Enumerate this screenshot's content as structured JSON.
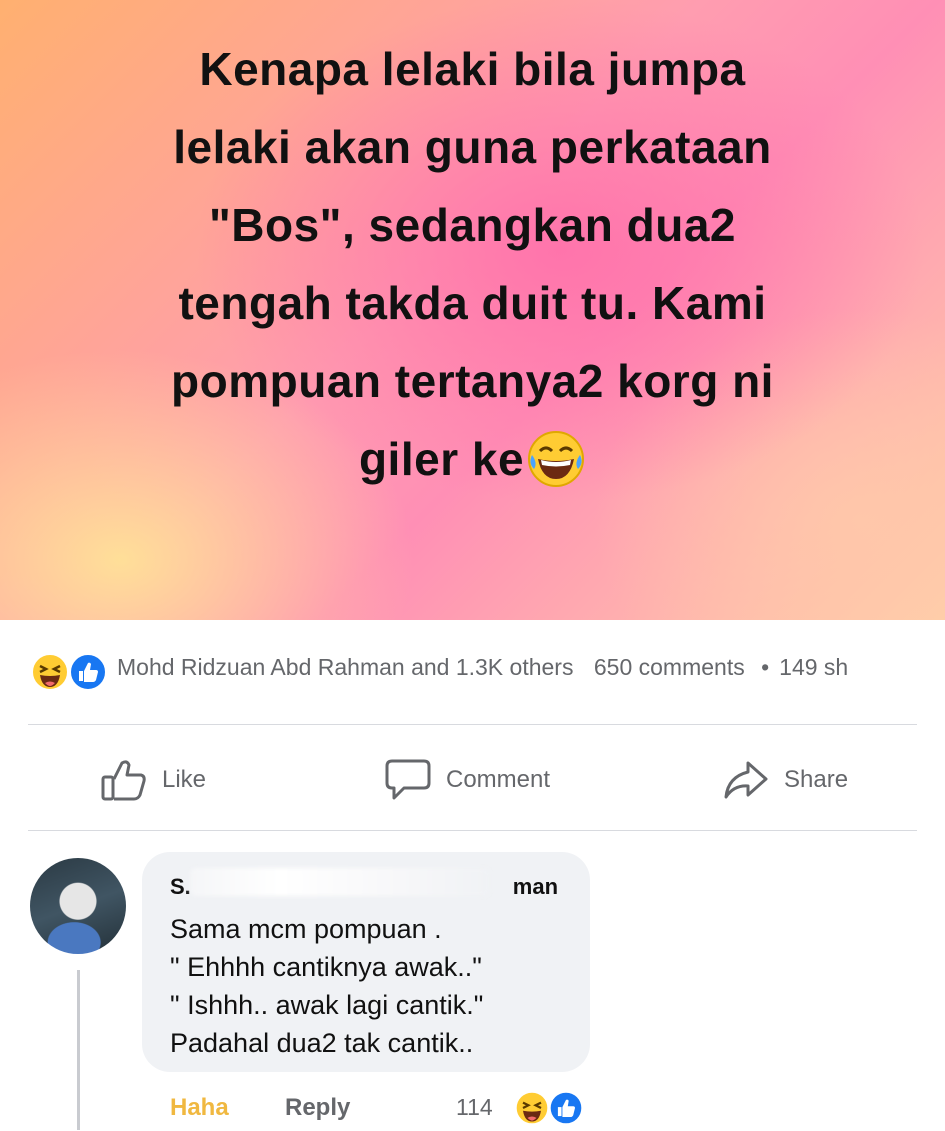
{
  "post": {
    "text_lines": [
      "Kenapa lelaki bila jumpa",
      "lelaki akan guna perkataan",
      "\"Bos\", sedangkan dua2",
      "tengah takda duit tu. Kami",
      "pompuan tertanya2 korg ni",
      "giler ke"
    ],
    "background_colors": [
      "#ffb070",
      "#ff8fb5",
      "#ffe69a"
    ]
  },
  "stats": {
    "reactors": "Mohd Ridzuan Abd Rahman and 1.3K others",
    "comments": "650 comments",
    "separator": "•",
    "shares": "149 sh",
    "reaction_icons": [
      "haha-icon",
      "like-icon"
    ]
  },
  "actions": {
    "like": "Like",
    "comment": "Comment",
    "share": "Share"
  },
  "comment": {
    "author_visible": "S…man",
    "author_start": "S.",
    "author_end": "man",
    "lines": [
      "Sama mcm pompuan .",
      "\" Ehhhh cantiknya awak..\"",
      "\" Ishhh.. awak lagi cantik.\"",
      "Padahal dua2 tak cantik.."
    ],
    "haha_label": "Haha",
    "reply_label": "Reply",
    "reaction_count": "114"
  },
  "colors": {
    "secondary_text": "#65676b",
    "haha_yellow": "#f0b840",
    "like_blue": "#1877f2",
    "bubble_bg": "#f0f2f5"
  }
}
